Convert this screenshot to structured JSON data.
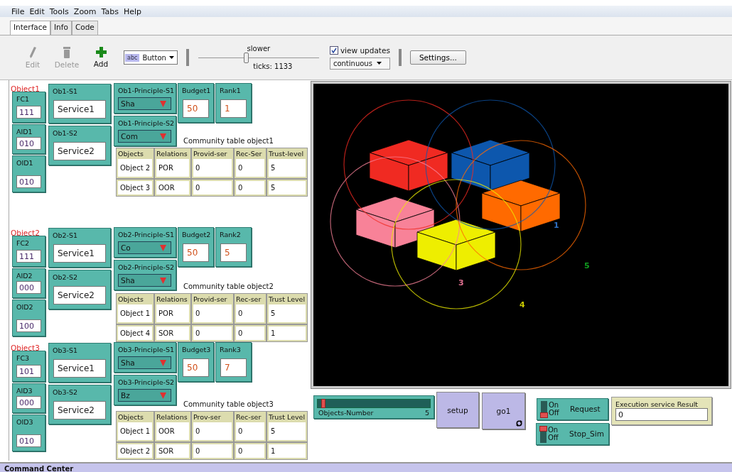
{
  "menu": [
    "File",
    "Edit",
    "Tools",
    "Zoom",
    "Tabs",
    "Help"
  ],
  "tabs": [
    {
      "label": "Interface",
      "selected": true
    },
    {
      "label": "Info",
      "selected": false
    },
    {
      "label": "Code",
      "selected": false
    }
  ],
  "toolbar": {
    "tools": [
      {
        "kind": "edit",
        "label": "Edit",
        "disabled": true
      },
      {
        "kind": "delete",
        "label": "Delete",
        "disabled": true
      },
      {
        "kind": "add",
        "label": "Add",
        "disabled": false
      }
    ],
    "widget_type_icon": "abc",
    "widget_type": "Button",
    "speed": {
      "label": "slower",
      "level": 0.38,
      "ticks": "ticks: 1133"
    },
    "view_updates": {
      "label": "view updates",
      "checked": true
    },
    "update_mode": "continuous",
    "settings": "Settings..."
  },
  "objects": [
    {
      "title": "Object1",
      "fields": [
        {
          "label": "FC1",
          "value": "111"
        },
        {
          "label": "AID1",
          "value": "010"
        },
        {
          "label": "OID1",
          "value": "010"
        }
      ],
      "services": [
        {
          "label": "Ob1-S1",
          "value": "Service1"
        },
        {
          "label": "Ob1-S2",
          "value": "Service2"
        }
      ],
      "principles": [
        {
          "label": "Ob1-Principle-S1",
          "value": "Sha"
        },
        {
          "label": "Ob1-Principle-S2",
          "value": "Com"
        }
      ],
      "budget": {
        "label": "Budget1",
        "value": "50"
      },
      "rank": {
        "label": "Rank1",
        "value": "1"
      },
      "table": {
        "title": "Community table object1",
        "columns": [
          "Objects",
          "Relations",
          "Provid-ser",
          "Rec-Ser",
          "Trust-level"
        ],
        "rows": [
          [
            "Object 2",
            "POR",
            "0",
            "0",
            "5"
          ],
          [
            "Object 3",
            "OOR",
            "0",
            "0",
            "5"
          ]
        ]
      }
    },
    {
      "title": "Object2",
      "fields": [
        {
          "label": "FC2",
          "value": "111"
        },
        {
          "label": "AID2",
          "value": "000"
        },
        {
          "label": "OID2",
          "value": "100"
        }
      ],
      "services": [
        {
          "label": "Ob2-S1",
          "value": "Service1"
        },
        {
          "label": "Ob2-S2",
          "value": "Service2"
        }
      ],
      "principles": [
        {
          "label": "Ob2-Principle-S1",
          "value": "Co"
        },
        {
          "label": "Ob2-Principle-S2",
          "value": "Sha"
        }
      ],
      "budget": {
        "label": "Budget2",
        "value": "50"
      },
      "rank": {
        "label": "Rank2",
        "value": "5"
      },
      "table": {
        "title": "Community table object2",
        "columns": [
          "Objects",
          "Relations",
          "Provid-ser",
          "Rec-ser",
          "Trust Level"
        ],
        "rows": [
          [
            "Object 1",
            "POR",
            "0",
            "0",
            "5"
          ],
          [
            "Object 4",
            "SOR",
            "0",
            "0",
            "1"
          ]
        ]
      }
    },
    {
      "title": "Object3",
      "fields": [
        {
          "label": "FC3",
          "value": "101"
        },
        {
          "label": "AID3",
          "value": "000"
        },
        {
          "label": "OID3",
          "value": "010"
        }
      ],
      "services": [
        {
          "label": "Ob3-S1",
          "value": "Service1"
        },
        {
          "label": "Ob3-S2",
          "value": "Service2"
        }
      ],
      "principles": [
        {
          "label": "Ob3-Principle-S1",
          "value": "Sha"
        },
        {
          "label": "Ob3-Principle-S2",
          "value": "Bz"
        }
      ],
      "budget": {
        "label": "Budget3",
        "value": "50"
      },
      "rank": {
        "label": "Rank3",
        "value": "7"
      },
      "table": {
        "title": "Community table object3",
        "columns": [
          "Objects",
          "Relations",
          "Prov-ser",
          "Rec-ser",
          "Trust Level"
        ],
        "rows": [
          [
            "Object 1",
            "OOR",
            "0",
            "0",
            "5"
          ],
          [
            "Object 2",
            "SOR",
            "0",
            "0",
            "1"
          ]
        ]
      }
    }
  ],
  "world": {
    "cubes": [
      {
        "color": "#f02a22"
      },
      {
        "color": "#0d57ad"
      },
      {
        "color": "#f88298"
      },
      {
        "color": "#ff6a00"
      },
      {
        "color": "#eeee00"
      }
    ],
    "labels": [
      {
        "text": "1",
        "color": "#2f6fc0"
      },
      {
        "text": "3",
        "color": "#e07090"
      },
      {
        "text": "4",
        "color": "#c8c800"
      },
      {
        "text": "5",
        "color": "#10a020"
      }
    ]
  },
  "controls": {
    "slider": {
      "label": "Objects-Number",
      "value": "5",
      "level": 0.03
    },
    "buttons": [
      {
        "label": "setup",
        "forever": false
      },
      {
        "label": "go1",
        "forever": true
      }
    ],
    "switches": [
      {
        "label": "Request",
        "on": false,
        "on_text": "On",
        "off_text": "Off"
      },
      {
        "label": "Stop_Sim",
        "on": true,
        "on_text": "On",
        "off_text": "Off"
      }
    ],
    "monitor": {
      "label": "Execution service Result",
      "value": "0"
    }
  },
  "command_center": "Command Center"
}
